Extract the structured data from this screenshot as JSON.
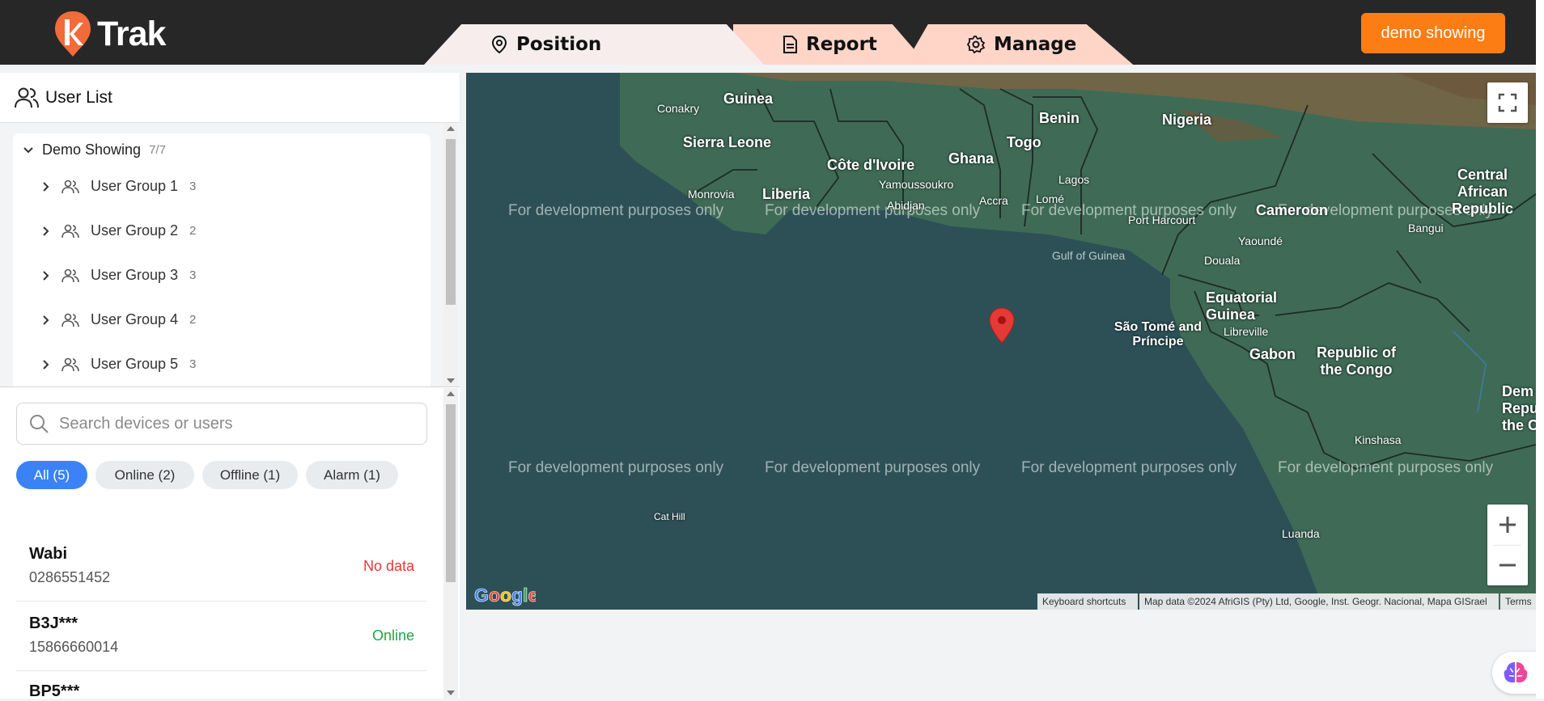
{
  "header": {
    "logo_text": "Trak",
    "tabs": [
      {
        "label": "Position",
        "icon": "map-pin-icon"
      },
      {
        "label": "Report",
        "icon": "document-icon"
      },
      {
        "label": "Manage",
        "icon": "gear-icon"
      }
    ],
    "account_button": "demo showing"
  },
  "sidebar": {
    "title": "User List",
    "tree": {
      "root_label": "Demo Showing",
      "root_count": "7/7",
      "groups": [
        {
          "label": "User Group 1",
          "count": "3"
        },
        {
          "label": "User Group 2",
          "count": "2"
        },
        {
          "label": "User Group 3",
          "count": "3"
        },
        {
          "label": "User Group 4",
          "count": "2"
        },
        {
          "label": "User Group 5",
          "count": "3"
        }
      ]
    },
    "search_placeholder": "Search devices or users",
    "filters": [
      {
        "label": "All (5)",
        "active": true
      },
      {
        "label": "Online (2)",
        "active": false
      },
      {
        "label": "Offline (1)",
        "active": false
      },
      {
        "label": "Alarm (1)",
        "active": false
      }
    ],
    "devices": [
      {
        "name": "Wabi",
        "number": "0286551452",
        "status": "No data",
        "status_color": "#e53935"
      },
      {
        "name": "B3J***",
        "number": "15866660014",
        "status": "Online",
        "status_color": "#22a447"
      },
      {
        "name": "BP5***",
        "number": "",
        "status": "",
        "status_color": "#22a447"
      }
    ]
  },
  "map": {
    "watermark": "For development purposes only",
    "labels": {
      "guinea": "Guinea",
      "conakry": "Conakry",
      "sierra_leone": "Sierra Leone",
      "monrovia": "Monrovia",
      "liberia": "Liberia",
      "cote": "Côte d'Ivoire",
      "yamoussoukro": "Yamoussoukro",
      "abidjan": "Abidjan",
      "ghana": "Ghana",
      "accra": "Accra",
      "togo": "Togo",
      "lome": "Lomé",
      "benin": "Benin",
      "nigeria": "Nigeria",
      "lagos": "Lagos",
      "port_harcourt": "Port Harcourt",
      "gulf": "Gulf of Guinea",
      "yaounde": "Yaoundé",
      "douala": "Douala",
      "cameroon": "Cameroon",
      "car": "Central African Republic",
      "bangui": "Bangui",
      "eq_guinea": "Equatorial Guinea",
      "libreville": "Libreville",
      "sao_tome": "São Tomé and Príncipe",
      "gabon": "Gabon",
      "congo": "Republic of the Congo",
      "drc": "Dem Repu the C",
      "kinshasa": "Kinshasa",
      "luanda": "Luanda",
      "cat_hill": "Cat Hill"
    },
    "attribution": {
      "shortcuts": "Keyboard shortcuts",
      "data": "Map data ©2024 AfriGIS (Pty) Ltd, Google, Inst. Geogr. Nacional, Mapa GISrael",
      "terms": "Terms"
    },
    "google_logo": "Google"
  },
  "colors": {
    "header_bg": "#272727",
    "accent": "#fb7d13",
    "chip_active": "#3b82f6",
    "ocean": "#2d5057",
    "land": "#3d6b55",
    "marker": "#e53935"
  }
}
